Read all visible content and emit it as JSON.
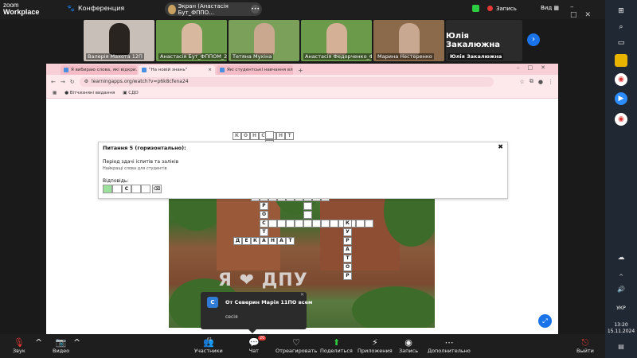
{
  "zoom": {
    "logo_line1": "zoom",
    "logo_line2": "Workplace",
    "conference_label": "Конференция",
    "share_label": "Экран (Анастасія Бут_ФППО…",
    "recording_label": "Запись",
    "view_label": "Вид",
    "participants": [
      {
        "name": "Валерія Махота 12П",
        "bg": "#c8c0b8",
        "face": "#2a2420"
      },
      {
        "name": "Анастасія Бут_ФППОМ_2",
        "bg": "#6a9a4a",
        "face": "#d9b8a0"
      },
      {
        "name": "Тетяна Мухіна",
        "bg": "#7aa05a",
        "face": "#caa890"
      },
      {
        "name": "Анастасія Федорченко_ФП…",
        "bg": "#6a9a4a",
        "face": "#d4b096"
      },
      {
        "name": "Марина Нестеренко",
        "bg": "#8a6a4a",
        "face": "#c8a890"
      },
      {
        "name": "Юлія Закалюжна",
        "bg": "#2b2b2b",
        "face": ""
      }
    ],
    "big_name": "Юлія Закалюжна",
    "bottom": {
      "mic": "Звук",
      "video": "Видео",
      "participants": "Участники",
      "participants_count": "61",
      "chat": "Чат",
      "chat_badge": "20",
      "react": "Отреагировать",
      "share": "Поделиться",
      "apps": "Приложения",
      "record": "Запись",
      "more": "Дополнительно",
      "leave": "Выйти"
    },
    "toast": {
      "avatar": "С",
      "from": "От Северин Марія 11ПО всем",
      "message": "сесія"
    }
  },
  "browser": {
    "tabs": [
      {
        "label": "Я вибираю слова, які відкри…",
        "active": false
      },
      {
        "label": "\"На новій знань\"",
        "active": true
      },
      {
        "label": "Які студентські навчання вл…",
        "active": false
      }
    ],
    "url": "learningapps.org/watch?v=p6k8cfena24",
    "bookmarks": [
      "Вітчизняні видання",
      "СДО"
    ]
  },
  "question": {
    "title": "Питання 5 (горизонтально):",
    "clue": "Період здачі іспитів та заліків",
    "hint": "Найкращі слова для студентів",
    "answer_label": "Відповідь:",
    "answer_cells": [
      "",
      "",
      "С",
      "",
      ""
    ],
    "close": "✖"
  },
  "crossword": {
    "sign_text": "Я ❤ ДПУ",
    "top_word": "КОНСЕНТ",
    "vertical_word": [
      "С",
      "Т",
      "А",
      "Р",
      "О",
      "С",
      "Т",
      "А"
    ],
    "horizontal_word": [
      "Д",
      "Е",
      "К",
      "А",
      "Н",
      "А",
      "Т"
    ],
    "vertical_word2": [
      "К",
      "У",
      "Р",
      "А",
      "Т",
      "О",
      "Р"
    ]
  },
  "taskbar": {
    "lang": "УКР",
    "time": "13:20",
    "date": "15.11.2024"
  }
}
